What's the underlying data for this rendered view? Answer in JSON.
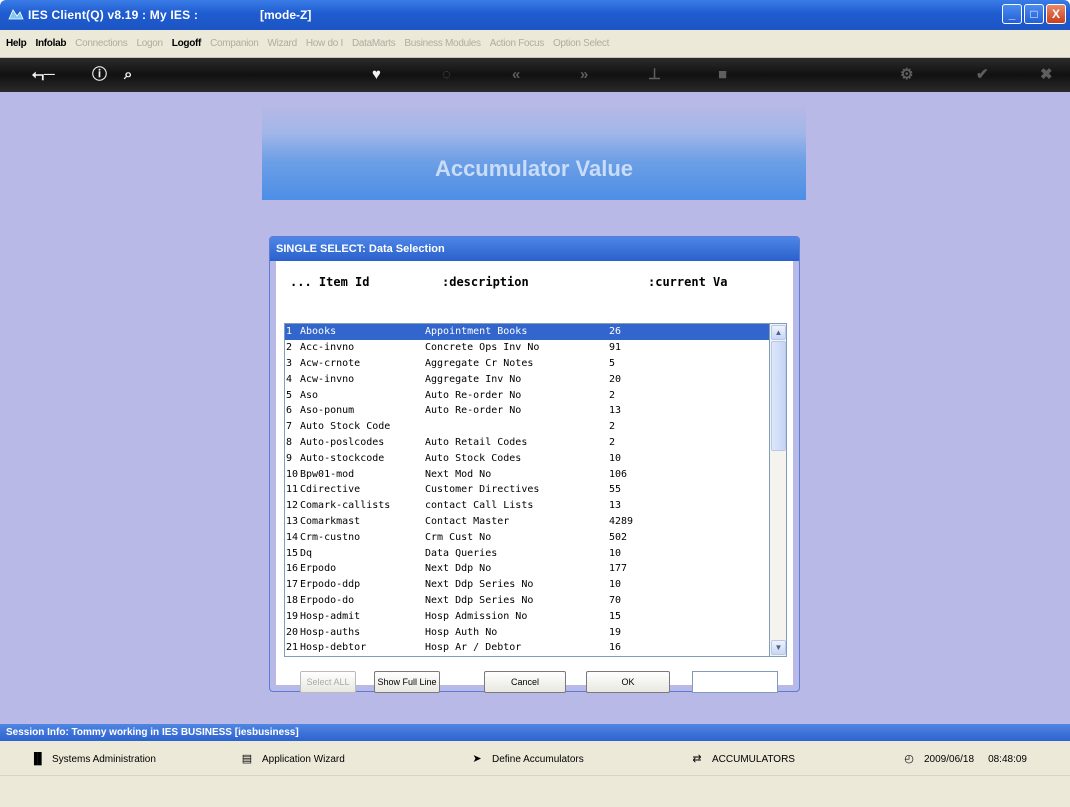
{
  "window": {
    "title": "IES Client(Q) v8.19 : My IES :",
    "mode": "[mode-Z]",
    "controls": [
      "_",
      "□",
      "X"
    ]
  },
  "menu": {
    "items": [
      {
        "label": "Help",
        "enabled": true
      },
      {
        "label": "Infolab",
        "enabled": true
      },
      {
        "label": "Connections",
        "enabled": false
      },
      {
        "label": "Logon",
        "enabled": false
      },
      {
        "label": "Logoff",
        "enabled": true
      },
      {
        "label": "Companion",
        "enabled": false
      },
      {
        "label": "Wizard",
        "enabled": false
      },
      {
        "label": "How do I",
        "enabled": false
      },
      {
        "label": "DataMarts",
        "enabled": false
      },
      {
        "label": "Business Modules",
        "enabled": false
      },
      {
        "label": "Action Focus",
        "enabled": false
      },
      {
        "label": "Option Select",
        "enabled": false
      }
    ]
  },
  "toolbar": {
    "icons": [
      "back-key-icon",
      "help-icon",
      "search-icon",
      "heart-icon",
      "refresh-icon",
      "prev-icon",
      "next-icon",
      "tree-icon",
      "stop-icon",
      "settings-icon",
      "check-icon",
      "close-icon"
    ]
  },
  "banner": {
    "title": "Accumulator Value"
  },
  "dialog": {
    "title": "SINGLE SELECT: Data Selection",
    "headers": {
      "item_id": "... Item Id",
      "description": ":description",
      "current_value": ":current Va"
    },
    "rows": [
      {
        "n": "1",
        "id": "Abooks",
        "desc": "Appointment Books",
        "val": "26"
      },
      {
        "n": "2",
        "id": "Acc-invno",
        "desc": "Concrete Ops Inv No",
        "val": "91"
      },
      {
        "n": "3",
        "id": "Acw-crnote",
        "desc": "Aggregate Cr Notes",
        "val": "5"
      },
      {
        "n": "4",
        "id": "Acw-invno",
        "desc": "Aggregate Inv No",
        "val": "20"
      },
      {
        "n": "5",
        "id": "Aso",
        "desc": "Auto Re-order No",
        "val": "2"
      },
      {
        "n": "6",
        "id": "Aso-ponum",
        "desc": "Auto Re-order No",
        "val": "13"
      },
      {
        "n": "7",
        "id": "Auto Stock Code",
        "desc": "",
        "val": "2"
      },
      {
        "n": "8",
        "id": "Auto-poslcodes",
        "desc": "Auto Retail Codes",
        "val": "2"
      },
      {
        "n": "9",
        "id": "Auto-stockcode",
        "desc": "Auto Stock Codes",
        "val": "10"
      },
      {
        "n": "10",
        "id": "Bpw01-mod",
        "desc": "Next Mod No",
        "val": "106"
      },
      {
        "n": "11",
        "id": "Cdirective",
        "desc": "Customer Directives",
        "val": "55"
      },
      {
        "n": "12",
        "id": "Comark-callists",
        "desc": "contact Call Lists",
        "val": "13"
      },
      {
        "n": "13",
        "id": "Comarkmast",
        "desc": "Contact Master",
        "val": "4289"
      },
      {
        "n": "14",
        "id": "Crm-custno",
        "desc": "Crm Cust No",
        "val": "502"
      },
      {
        "n": "15",
        "id": "Dq",
        "desc": "Data Queries",
        "val": "10"
      },
      {
        "n": "16",
        "id": "Erpodo",
        "desc": "Next Ddp No",
        "val": "177"
      },
      {
        "n": "17",
        "id": "Erpodo-ddp",
        "desc": "Next Ddp Series No",
        "val": "10"
      },
      {
        "n": "18",
        "id": "Erpodo-do",
        "desc": "Next Ddp Series No",
        "val": "70"
      },
      {
        "n": "19",
        "id": "Hosp-admit",
        "desc": "Hosp Admission No",
        "val": "15"
      },
      {
        "n": "20",
        "id": "Hosp-auths",
        "desc": "Hosp Auth No",
        "val": "19"
      },
      {
        "n": "21",
        "id": "Hosp-debtor",
        "desc": "Hosp Ar / Debtor",
        "val": "16"
      }
    ],
    "selected_index": 0,
    "buttons": {
      "select_all": "Select ALL",
      "show_full_line": "Show Full Line",
      "cancel": "Cancel",
      "ok": "OK"
    },
    "input_value": ""
  },
  "session": {
    "info": "Session Info: Tommy working in IES BUSINESS  [iesbusiness]"
  },
  "status": {
    "systems_admin": "Systems Administration",
    "app_wizard": "Application Wizard",
    "define_acc": "Define Accumulators",
    "accumulators": "ACCUMULATORS",
    "date": "2009/06/18",
    "time": "08:48:09"
  },
  "colors": {
    "workspace": "#b8b9e6",
    "selection": "#3366cc",
    "titlebar": "#1f5cd0"
  }
}
